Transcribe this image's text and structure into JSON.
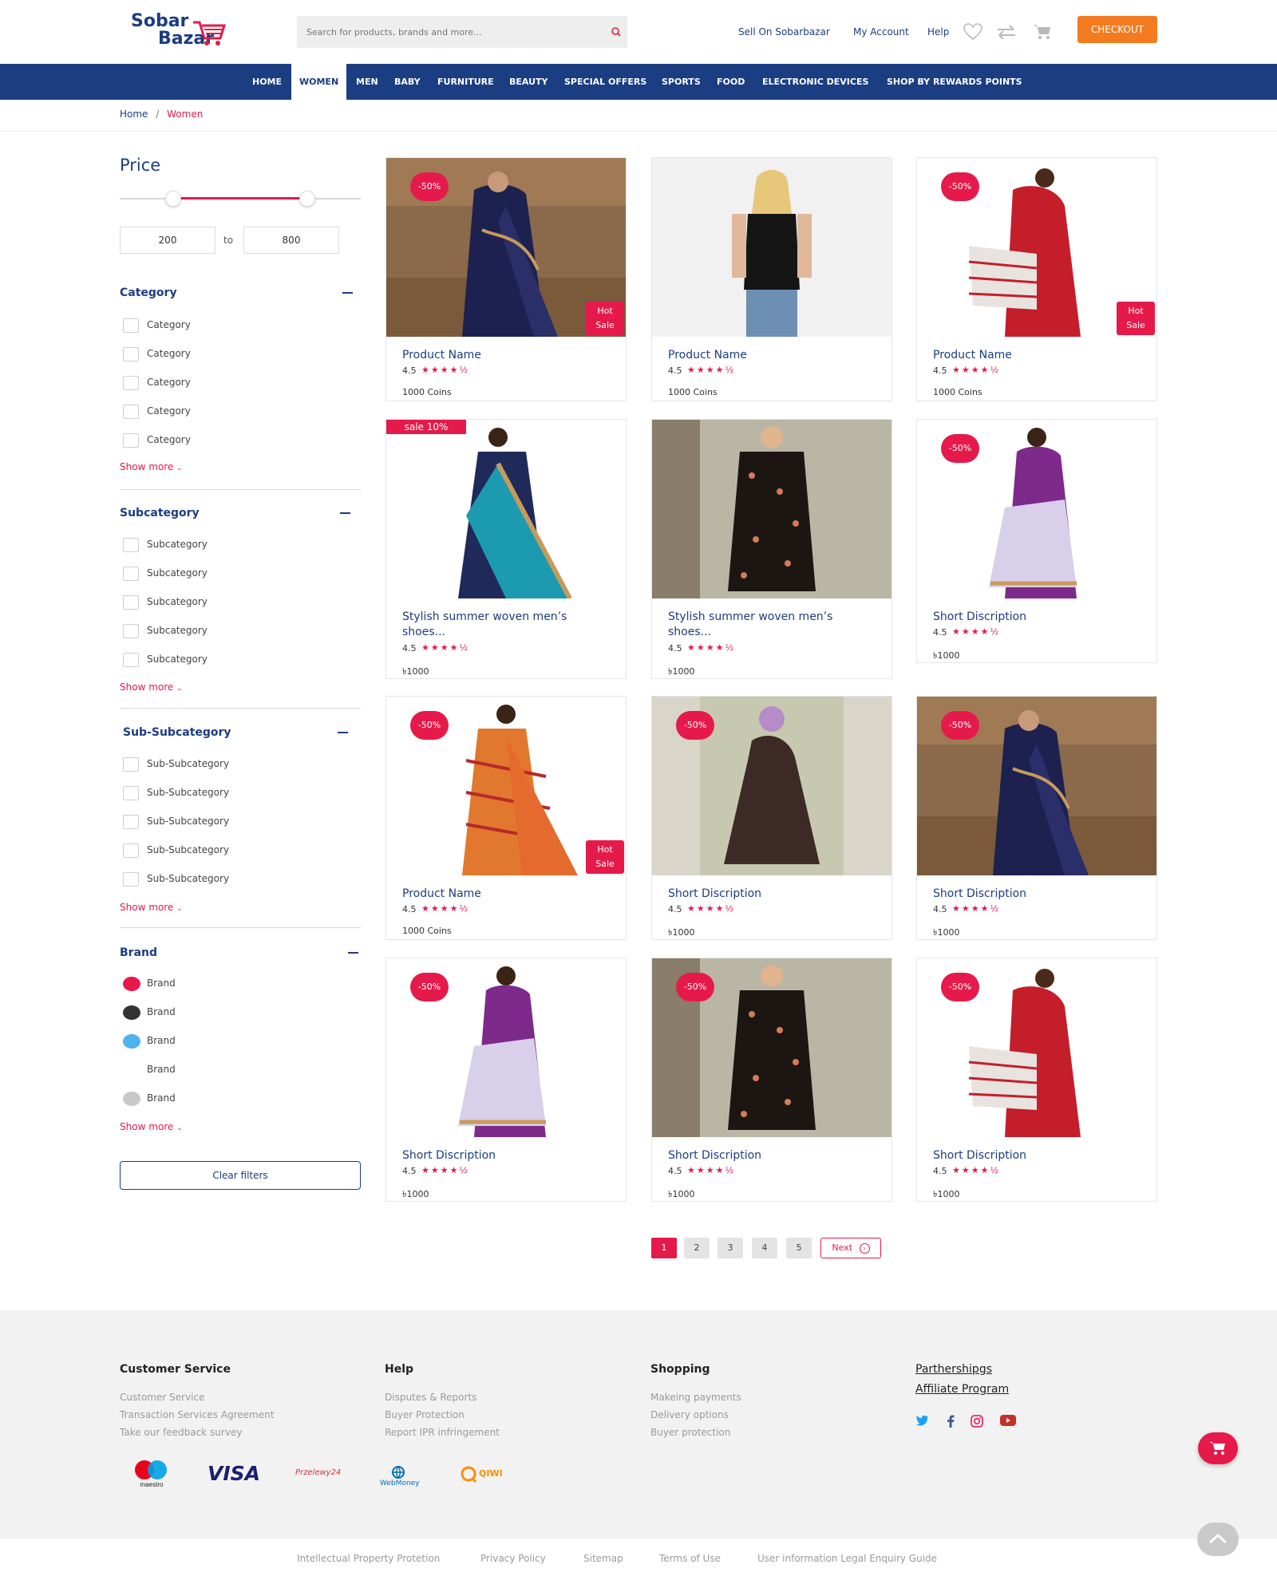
{
  "header": {
    "logo_line1": "Sobar",
    "logo_line2": "Bazar",
    "search_placeholder": "Search for products, brands and more...",
    "sell_link": "Sell On Sobarbazar",
    "account_link": "My Account",
    "help_link": "Help",
    "checkout_label": "CHECKOUT"
  },
  "nav": {
    "items": [
      "HOME",
      "WOMEN",
      "MEN",
      "BABY",
      "FURNITURE",
      "BEAUTY",
      "SPECIAL OFFERS",
      "SPORTS",
      "FOOD",
      "ELECTRONIC DEVICES",
      "SHOP BY REWARDS POINTS"
    ],
    "active": "WOMEN"
  },
  "breadcrumb": {
    "home": "Home",
    "separator": "/",
    "current": "Women"
  },
  "filters": {
    "price": {
      "title": "Price",
      "min": "200",
      "to_label": "to",
      "max": "800"
    },
    "category": {
      "title": "Category",
      "options": [
        "Category",
        "Category",
        "Category",
        "Category",
        "Category"
      ],
      "show_more": "Show more"
    },
    "subcategory": {
      "title": "Subcategory",
      "options": [
        "Subcategory",
        "Subcategory",
        "Subcategory",
        "Subcategory",
        "Subcategory"
      ],
      "show_more": "Show more"
    },
    "subsubcategory": {
      "title": "Sub-Subcategory",
      "options": [
        "Sub-Subcategory",
        "Sub-Subcategory",
        "Sub-Subcategory",
        "Sub-Subcategory",
        "Sub-Subcategory"
      ],
      "show_more": "Show more"
    },
    "brand": {
      "title": "Brand",
      "options": [
        {
          "label": "Brand",
          "color": "#e51a4b"
        },
        {
          "label": "Brand",
          "color": "#333333"
        },
        {
          "label": "Brand",
          "color": "#4fb3ee"
        },
        {
          "label": "Brand",
          "color": ""
        },
        {
          "label": "Brand",
          "color": "#c8c8c8"
        }
      ],
      "show_more": "Show more"
    },
    "clear_label": "Clear filters"
  },
  "products": [
    {
      "name": "Product Name",
      "rating": "4.5",
      "price": "1000 Coins",
      "badge": "-50%",
      "hot_line1": "Hot",
      "hot_line2": "Sale",
      "image": "navy-saree"
    },
    {
      "name": "Product Name",
      "rating": "4.5",
      "price": "1000 Coins",
      "image": "black-top"
    },
    {
      "name": "Product Name",
      "rating": "4.5",
      "price": "1000 Coins",
      "badge": "-50%",
      "hot_line1": "Hot",
      "hot_line2": "Sale",
      "image": "red-saree"
    },
    {
      "name": "Stylish summer woven men’s shoes...",
      "rating": "4.5",
      "price": "৳1000",
      "sale_tag": "sale 10%",
      "image": "teal-saree"
    },
    {
      "name": "Stylish summer woven men’s shoes...",
      "rating": "4.5",
      "price": "৳1000",
      "image": "floral-dress"
    },
    {
      "name": "Short Discription",
      "rating": "4.5",
      "price": "৳1000",
      "badge": "-50%",
      "image": "purple-saree"
    },
    {
      "name": "Product Name",
      "rating": "4.5",
      "price": "1000 Coins",
      "badge": "-50%",
      "hot_line1": "Hot",
      "hot_line2": "Sale",
      "image": "orange-saree"
    },
    {
      "name": "Short Discription",
      "rating": "4.5",
      "price": "৳1000",
      "badge": "-50%",
      "image": "brown-abaya"
    },
    {
      "name": "Short Discription",
      "rating": "4.5",
      "price": "৳1000",
      "badge": "-50%",
      "image": "navy-saree"
    },
    {
      "name": "Short Discription",
      "rating": "4.5",
      "price": "৳1000",
      "badge": "-50%",
      "image": "purple-saree"
    },
    {
      "name": "Short Discription",
      "rating": "4.5",
      "price": "৳1000",
      "badge": "-50%",
      "image": "floral-dress"
    },
    {
      "name": "Short Discription",
      "rating": "4.5",
      "price": "৳1000",
      "badge": "-50%",
      "image": "red-saree"
    }
  ],
  "pagination": {
    "pages": [
      "1",
      "2",
      "3",
      "4",
      "5"
    ],
    "active": "1",
    "next_label": "Next"
  },
  "footer": {
    "customer_service": {
      "title": "Customer Service",
      "links": [
        "Customer Service",
        "Transaction Services Agreement",
        "Take our feedback survey"
      ]
    },
    "help": {
      "title": "Help",
      "links": [
        "Disputes & Reports",
        "Buyer Protection",
        "Report IPR infringement"
      ]
    },
    "shopping": {
      "title": "Shopping",
      "links": [
        "Makeing payments",
        "Delivery options",
        "Buyer protection"
      ]
    },
    "partner_links": [
      "Parthershipgs",
      "Affiliate Program"
    ],
    "social": [
      "twitter-icon",
      "facebook-icon",
      "instagram-icon",
      "youtube-icon"
    ],
    "payments": {
      "maestro": "maestro",
      "visa": "VISA",
      "przelewy": "Przelewy24",
      "webmoney": "WebMoney",
      "qiwi": "QIWI"
    },
    "bottom_links": [
      "Intellectual Property Protetion",
      "Privacy Policy",
      "Sitemap",
      "Terms of Use",
      "User information Legal Enquiry Guide"
    ]
  },
  "colors": {
    "brand_blue": "#1b3d82",
    "accent_red": "#e51a4b",
    "checkout_orange": "#f47b20"
  }
}
